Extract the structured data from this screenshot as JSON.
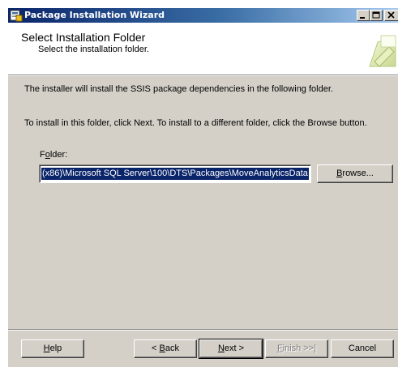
{
  "window": {
    "title": "Package Installation Wizard"
  },
  "header": {
    "title": "Select Installation Folder",
    "subtitle": "Select the installation folder."
  },
  "body": {
    "line1": "The installer will install the SSIS package dependencies in the following folder.",
    "line2": "To install in this folder, click Next. To install to a different folder, click the Browse button."
  },
  "folder": {
    "label_pre": "F",
    "label_accel": "o",
    "label_post": "lder:",
    "value": "(x86)\\Microsoft SQL Server\\100\\DTS\\Packages\\MoveAnalyticsData"
  },
  "buttons": {
    "browse_accel": "B",
    "browse_rest": "rowse...",
    "help_accel": "H",
    "help_rest": "elp",
    "back_pre": "< ",
    "back_accel": "B",
    "back_rest": "ack",
    "next_accel": "N",
    "next_rest": "ext >",
    "finish_accel": "F",
    "finish_rest": "inish >>|",
    "cancel_label": "Cancel"
  },
  "colors": {
    "face": "#d4d0c8",
    "title_active": "#0a246a",
    "selection": "#0a246a"
  }
}
